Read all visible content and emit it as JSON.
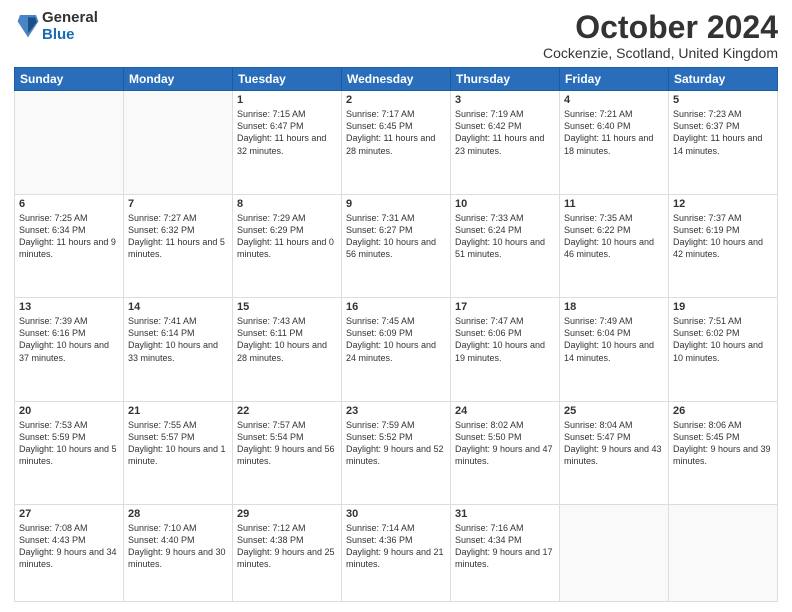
{
  "logo": {
    "general": "General",
    "blue": "Blue"
  },
  "header": {
    "month": "October 2024",
    "location": "Cockenzie, Scotland, United Kingdom"
  },
  "days_of_week": [
    "Sunday",
    "Monday",
    "Tuesday",
    "Wednesday",
    "Thursday",
    "Friday",
    "Saturday"
  ],
  "weeks": [
    [
      {
        "day": "",
        "sunrise": "",
        "sunset": "",
        "daylight": ""
      },
      {
        "day": "",
        "sunrise": "",
        "sunset": "",
        "daylight": ""
      },
      {
        "day": "1",
        "sunrise": "Sunrise: 7:15 AM",
        "sunset": "Sunset: 6:47 PM",
        "daylight": "Daylight: 11 hours and 32 minutes."
      },
      {
        "day": "2",
        "sunrise": "Sunrise: 7:17 AM",
        "sunset": "Sunset: 6:45 PM",
        "daylight": "Daylight: 11 hours and 28 minutes."
      },
      {
        "day": "3",
        "sunrise": "Sunrise: 7:19 AM",
        "sunset": "Sunset: 6:42 PM",
        "daylight": "Daylight: 11 hours and 23 minutes."
      },
      {
        "day": "4",
        "sunrise": "Sunrise: 7:21 AM",
        "sunset": "Sunset: 6:40 PM",
        "daylight": "Daylight: 11 hours and 18 minutes."
      },
      {
        "day": "5",
        "sunrise": "Sunrise: 7:23 AM",
        "sunset": "Sunset: 6:37 PM",
        "daylight": "Daylight: 11 hours and 14 minutes."
      }
    ],
    [
      {
        "day": "6",
        "sunrise": "Sunrise: 7:25 AM",
        "sunset": "Sunset: 6:34 PM",
        "daylight": "Daylight: 11 hours and 9 minutes."
      },
      {
        "day": "7",
        "sunrise": "Sunrise: 7:27 AM",
        "sunset": "Sunset: 6:32 PM",
        "daylight": "Daylight: 11 hours and 5 minutes."
      },
      {
        "day": "8",
        "sunrise": "Sunrise: 7:29 AM",
        "sunset": "Sunset: 6:29 PM",
        "daylight": "Daylight: 11 hours and 0 minutes."
      },
      {
        "day": "9",
        "sunrise": "Sunrise: 7:31 AM",
        "sunset": "Sunset: 6:27 PM",
        "daylight": "Daylight: 10 hours and 56 minutes."
      },
      {
        "day": "10",
        "sunrise": "Sunrise: 7:33 AM",
        "sunset": "Sunset: 6:24 PM",
        "daylight": "Daylight: 10 hours and 51 minutes."
      },
      {
        "day": "11",
        "sunrise": "Sunrise: 7:35 AM",
        "sunset": "Sunset: 6:22 PM",
        "daylight": "Daylight: 10 hours and 46 minutes."
      },
      {
        "day": "12",
        "sunrise": "Sunrise: 7:37 AM",
        "sunset": "Sunset: 6:19 PM",
        "daylight": "Daylight: 10 hours and 42 minutes."
      }
    ],
    [
      {
        "day": "13",
        "sunrise": "Sunrise: 7:39 AM",
        "sunset": "Sunset: 6:16 PM",
        "daylight": "Daylight: 10 hours and 37 minutes."
      },
      {
        "day": "14",
        "sunrise": "Sunrise: 7:41 AM",
        "sunset": "Sunset: 6:14 PM",
        "daylight": "Daylight: 10 hours and 33 minutes."
      },
      {
        "day": "15",
        "sunrise": "Sunrise: 7:43 AM",
        "sunset": "Sunset: 6:11 PM",
        "daylight": "Daylight: 10 hours and 28 minutes."
      },
      {
        "day": "16",
        "sunrise": "Sunrise: 7:45 AM",
        "sunset": "Sunset: 6:09 PM",
        "daylight": "Daylight: 10 hours and 24 minutes."
      },
      {
        "day": "17",
        "sunrise": "Sunrise: 7:47 AM",
        "sunset": "Sunset: 6:06 PM",
        "daylight": "Daylight: 10 hours and 19 minutes."
      },
      {
        "day": "18",
        "sunrise": "Sunrise: 7:49 AM",
        "sunset": "Sunset: 6:04 PM",
        "daylight": "Daylight: 10 hours and 14 minutes."
      },
      {
        "day": "19",
        "sunrise": "Sunrise: 7:51 AM",
        "sunset": "Sunset: 6:02 PM",
        "daylight": "Daylight: 10 hours and 10 minutes."
      }
    ],
    [
      {
        "day": "20",
        "sunrise": "Sunrise: 7:53 AM",
        "sunset": "Sunset: 5:59 PM",
        "daylight": "Daylight: 10 hours and 5 minutes."
      },
      {
        "day": "21",
        "sunrise": "Sunrise: 7:55 AM",
        "sunset": "Sunset: 5:57 PM",
        "daylight": "Daylight: 10 hours and 1 minute."
      },
      {
        "day": "22",
        "sunrise": "Sunrise: 7:57 AM",
        "sunset": "Sunset: 5:54 PM",
        "daylight": "Daylight: 9 hours and 56 minutes."
      },
      {
        "day": "23",
        "sunrise": "Sunrise: 7:59 AM",
        "sunset": "Sunset: 5:52 PM",
        "daylight": "Daylight: 9 hours and 52 minutes."
      },
      {
        "day": "24",
        "sunrise": "Sunrise: 8:02 AM",
        "sunset": "Sunset: 5:50 PM",
        "daylight": "Daylight: 9 hours and 47 minutes."
      },
      {
        "day": "25",
        "sunrise": "Sunrise: 8:04 AM",
        "sunset": "Sunset: 5:47 PM",
        "daylight": "Daylight: 9 hours and 43 minutes."
      },
      {
        "day": "26",
        "sunrise": "Sunrise: 8:06 AM",
        "sunset": "Sunset: 5:45 PM",
        "daylight": "Daylight: 9 hours and 39 minutes."
      }
    ],
    [
      {
        "day": "27",
        "sunrise": "Sunrise: 7:08 AM",
        "sunset": "Sunset: 4:43 PM",
        "daylight": "Daylight: 9 hours and 34 minutes."
      },
      {
        "day": "28",
        "sunrise": "Sunrise: 7:10 AM",
        "sunset": "Sunset: 4:40 PM",
        "daylight": "Daylight: 9 hours and 30 minutes."
      },
      {
        "day": "29",
        "sunrise": "Sunrise: 7:12 AM",
        "sunset": "Sunset: 4:38 PM",
        "daylight": "Daylight: 9 hours and 25 minutes."
      },
      {
        "day": "30",
        "sunrise": "Sunrise: 7:14 AM",
        "sunset": "Sunset: 4:36 PM",
        "daylight": "Daylight: 9 hours and 21 minutes."
      },
      {
        "day": "31",
        "sunrise": "Sunrise: 7:16 AM",
        "sunset": "Sunset: 4:34 PM",
        "daylight": "Daylight: 9 hours and 17 minutes."
      },
      {
        "day": "",
        "sunrise": "",
        "sunset": "",
        "daylight": ""
      },
      {
        "day": "",
        "sunrise": "",
        "sunset": "",
        "daylight": ""
      }
    ]
  ]
}
